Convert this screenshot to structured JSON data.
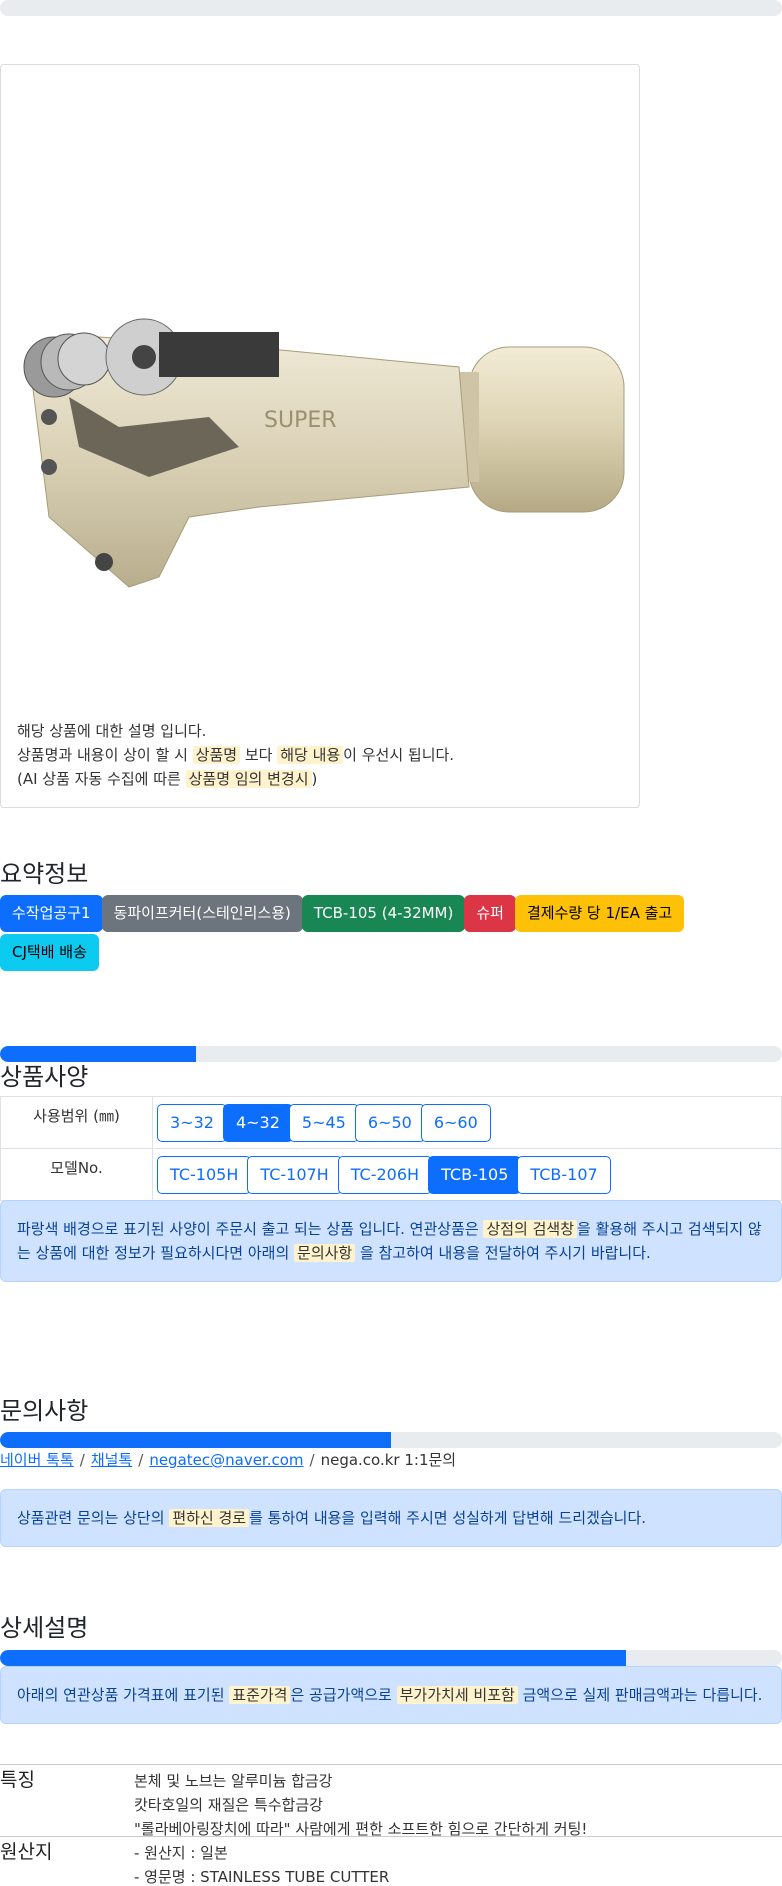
{
  "product": {
    "description_lines": [
      {
        "parts": [
          {
            "text": "해당 상품에 대한 설명 입니다.",
            "hl": false
          }
        ]
      },
      {
        "parts": [
          {
            "text": "상품명과 내용이 상이 할 시 ",
            "hl": false
          },
          {
            "text": "상품명",
            "hl": true
          },
          {
            "text": " 보다 ",
            "hl": false
          },
          {
            "text": "해당 내용",
            "hl": true
          },
          {
            "text": "이 우선시 됩니다.",
            "hl": false
          }
        ]
      },
      {
        "parts": [
          {
            "text": "(AI 상품 자동 수집에 따른 ",
            "hl": false
          },
          {
            "text": "상품명 임의 변경시",
            "hl": true
          },
          {
            "text": ")",
            "hl": false
          }
        ]
      }
    ]
  },
  "summary": {
    "title": "요약정보",
    "badges": [
      {
        "label": "수작업공구1",
        "color": "#0d6efd",
        "text": "#ffffff"
      },
      {
        "label": "동파이프커터(스테인리스용)",
        "color": "#6c757d",
        "text": "#ffffff"
      },
      {
        "label": "TCB-105 (4-32MM)",
        "color": "#198754",
        "text": "#ffffff"
      },
      {
        "label": "슈퍼",
        "color": "#dc3545",
        "text": "#ffffff"
      },
      {
        "label": "결제수량 당 1/EA 출고",
        "color": "#ffc107",
        "text": "#000000"
      },
      {
        "label": "CJ택배 배송",
        "color": "#0dcaf0",
        "text": "#000000"
      }
    ]
  },
  "spec": {
    "title": "상품사양",
    "progress": 0.25,
    "rows": [
      {
        "label": "사용범위 (㎜)",
        "options": [
          "3~32",
          "4~32",
          "5~45",
          "6~50",
          "6~60"
        ],
        "active": 1
      },
      {
        "label": "모델No.",
        "options": [
          "TC-105H",
          "TC-107H",
          "TC-206H",
          "TCB-105",
          "TCB-107"
        ],
        "active": 3
      }
    ],
    "notice_parts": [
      {
        "text": "파랑색 배경으로 표기된 사양이 주문시 출고 되는 상품 입니다. 연관상품은 ",
        "hl": false
      },
      {
        "text": "상점의 검색창",
        "hl": true
      },
      {
        "text": "을 활용해 주시고 검색되지 않는 상품에 대한 정보가 필요하시다면 아래의 ",
        "hl": false
      },
      {
        "text": "문의사항",
        "hl": true
      },
      {
        "text": " 을 참고하여 내용을 전달하여 주시기 바랍니다.",
        "hl": false
      }
    ]
  },
  "inquiry": {
    "title": "문의사항",
    "progress": 0.5,
    "links": [
      "네이버 톡톡",
      "채널톡",
      "negatec@naver.com"
    ],
    "plain": "nega.co.kr 1:1문의",
    "notice_parts": [
      {
        "text": "상품관련 문의는 상단의 ",
        "hl": false
      },
      {
        "text": "편하신 경로",
        "hl": true
      },
      {
        "text": "를 통하여 내용을 입력해 주시면 성실하게 답변해 드리겠습니다.",
        "hl": false
      }
    ]
  },
  "detail": {
    "title": "상세설명",
    "progress": 0.8,
    "notice_parts": [
      {
        "text": "아래의 연관상품 가격표에 표기된 ",
        "hl": false
      },
      {
        "text": "표준가격",
        "hl": true
      },
      {
        "text": "은 공급가액으로 ",
        "hl": false
      },
      {
        "text": "부가가치세 비포함",
        "hl": true
      },
      {
        "text": " 금액으로 실제 판매금액과는 다릅니다.",
        "hl": false
      }
    ],
    "features": [
      {
        "label": "특징",
        "items": [
          "본체 및 노브는 알루미늄 합금강",
          "캇타호일의 재질은 특수합금강",
          "\"롤라베아링장치에 따라\" 사람에게 편한 소프트한 힘으로 간단하게 커팅!"
        ]
      },
      {
        "label": "원산지",
        "items": [
          "- 원산지 : 일본",
          "- 영문명 : STAINLESS TUBE CUTTER"
        ]
      }
    ]
  },
  "colors": {
    "primary": "#0d6efd",
    "track": "#e9ecef",
    "alert_bg": "#cfe2ff",
    "highlight": "#fff3cd"
  }
}
